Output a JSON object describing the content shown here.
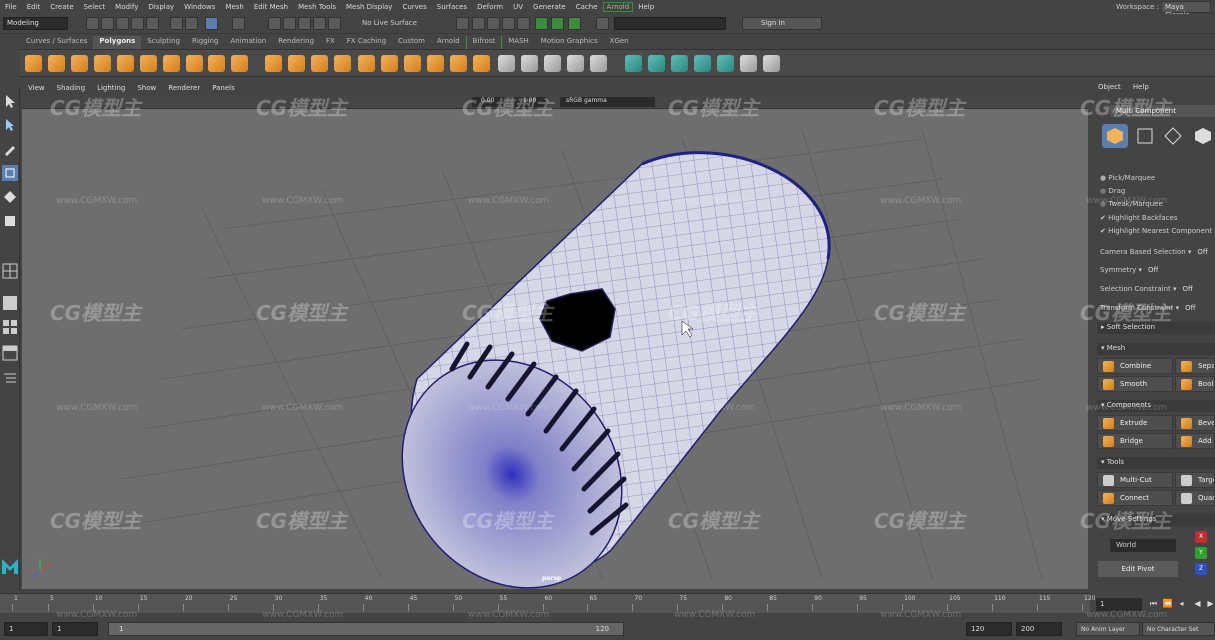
{
  "menu": [
    "File",
    "Edit",
    "Create",
    "Select",
    "Modify",
    "Display",
    "Windows",
    "Mesh",
    "Edit Mesh",
    "Mesh Tools",
    "Mesh Display",
    "Curves",
    "Surfaces",
    "Deform",
    "UV",
    "Generate",
    "Cache",
    "Arnold",
    "Help"
  ],
  "menu_highlight": "Arnold",
  "workspace": {
    "label": "Workspace :",
    "value": "Maya Classic"
  },
  "status": {
    "mode": "Modeling",
    "live_surface": "No Live Surface",
    "sign_in": "Sign In"
  },
  "shelf_tabs": [
    "Curves / Surfaces",
    "Polygons",
    "Sculpting",
    "Rigging",
    "Animation",
    "Rendering",
    "FX",
    "FX Caching",
    "Custom",
    "Arnold",
    "Bifrost",
    "MASH",
    "Motion Graphics",
    "XGen"
  ],
  "shelf_active": "Polygons",
  "viewport": {
    "menu": [
      "View",
      "Shading",
      "Lighting",
      "Show",
      "Renderer",
      "Panels"
    ],
    "field_a": "0.00",
    "field_b": "1.00",
    "color_space": "sRGB gamma",
    "camera": "persp"
  },
  "right_panel": {
    "menu": [
      "Object",
      "Help"
    ],
    "header": "Multi Component",
    "options": {
      "pick_marquee": "Pick/Marquee",
      "drag": "Drag",
      "tweak_marquee": "Tweak/Marquee",
      "highlight_backfaces": "Highlight Backfaces",
      "highlight_nearest": "Highlight Nearest Component"
    },
    "camera_based": {
      "label": "Camera Based Selection",
      "value": "Off"
    },
    "symmetry": {
      "label": "Symmetry",
      "value": "Off"
    },
    "selection_constraint": {
      "label": "Selection Constraint",
      "value": "Off"
    },
    "transform_constraint": {
      "label": "Transform Constraint",
      "value": "Off"
    },
    "soft_selection": "Soft Selection",
    "sections": {
      "mesh": "Mesh",
      "components": "Components",
      "tools": "Tools",
      "move_settings": "Move Settings"
    },
    "buttons": {
      "combine": "Combine",
      "separate": "Separate",
      "smooth": "Smooth",
      "boolean": "Boolean",
      "extrude": "Extrude",
      "bevel": "Bevel",
      "bridge": "Bridge",
      "add_divisions": "Add Divisions",
      "multi_cut": "Multi-Cut",
      "target_weld": "Target Weld",
      "connect": "Connect",
      "quad_draw": "Quad Draw"
    },
    "world": "World",
    "edit_pivot": "Edit Pivot",
    "axes": [
      "X",
      "Y",
      "Z"
    ]
  },
  "timeline": {
    "ticks": [
      "1",
      "5",
      "10",
      "15",
      "20",
      "25",
      "30",
      "35",
      "40",
      "45",
      "50",
      "55",
      "60",
      "65",
      "70",
      "75",
      "80",
      "85",
      "90",
      "95",
      "100",
      "105",
      "110",
      "115",
      "120"
    ],
    "current_frame": "1"
  },
  "range": {
    "start": "1",
    "start2": "1",
    "slider_start": "1",
    "slider_end": "120",
    "end": "120",
    "end2": "200",
    "anim_layer": "No Anim Layer",
    "character": "No Character Set"
  },
  "watermark": {
    "text": "CG模型主",
    "url": "www.CGMXW.com"
  }
}
